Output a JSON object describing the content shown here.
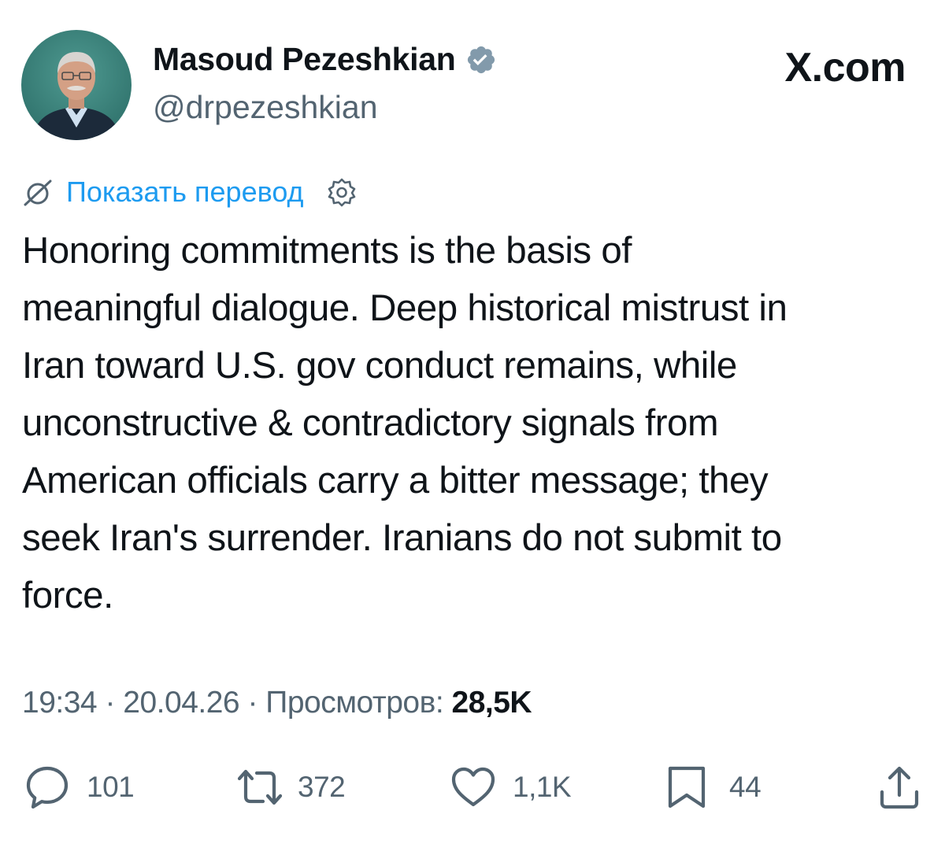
{
  "header": {
    "author_name": "Masoud Pezeshkian",
    "author_handle": "@drpezeshkian",
    "site_label": "X.com"
  },
  "translate": {
    "link_label": "Показать перевод"
  },
  "tweet": {
    "lines": [
      "Honoring commitments is the basis of",
      "meaningful dialogue. Deep historical mistrust in",
      "Iran toward U.S. gov conduct remains, while",
      "unconstructive & contradictory signals from",
      "American officials carry a bitter message; they",
      "seek Iran's surrender. Iranians do not submit to",
      "force."
    ]
  },
  "meta": {
    "time": "19:34",
    "separator": "·",
    "date": "20.04.26",
    "views_label": "Просмотров:",
    "views_count": "28,5K"
  },
  "actions": {
    "replies": "101",
    "reposts": "372",
    "likes": "1,1K",
    "bookmarks": "44"
  },
  "icons": {
    "avatar": "user-avatar-photo",
    "verified": "verified-badge-icon",
    "translate": "translate-globe-slash-icon",
    "settings": "gear-icon",
    "reply": "reply-bubble-icon",
    "repost": "repost-arrows-icon",
    "like": "heart-icon",
    "bookmark": "bookmark-icon",
    "share": "share-upload-icon"
  },
  "colors": {
    "text": "#0f1419",
    "secondary": "#536471",
    "link": "#1d9bf0",
    "verified_badge": "#829aab"
  }
}
